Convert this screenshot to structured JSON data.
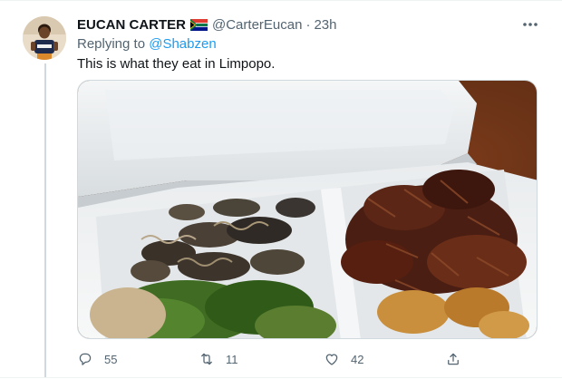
{
  "tweet": {
    "author_name": "EUCAN CARTER",
    "flag_icon": "south-africa-flag-icon",
    "handle": "@CarterEucan",
    "separator": "·",
    "time": "23h",
    "reply_prefix": "Replying to",
    "reply_mention": "@Shabzen",
    "text": "This is what they eat in Limpopo.",
    "media_description_icon": "food-container-photo"
  },
  "actions": {
    "reply_count": "55",
    "retweet_count": "11",
    "like_count": "42"
  },
  "colors": {
    "link": "#1d9bf0",
    "secondary_text": "#536471",
    "primary_text": "#0f1419",
    "border": "#eff3f4"
  }
}
